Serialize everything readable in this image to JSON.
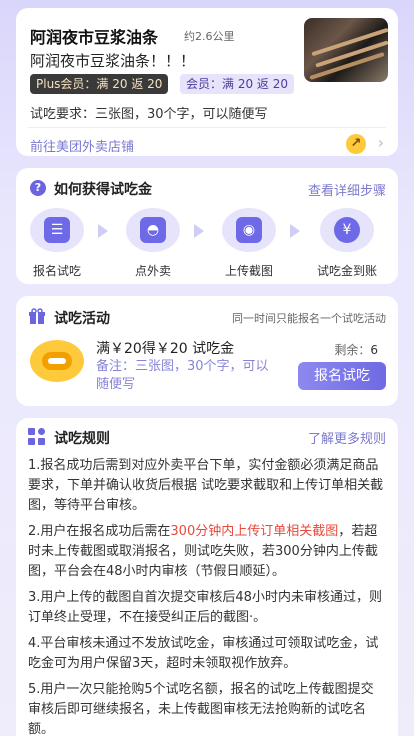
{
  "store": {
    "name": "阿润夜市豆浆油条",
    "distance": "约2.6公里",
    "subtitle": "阿润夜市豆浆油条！！！",
    "plus_badge": "Plus会员：满 20 返 20",
    "member_badge": "会员：满 20 返 20",
    "requirement": "试吃要求：三张图，30个字，可以随便写",
    "link_text": "前往美团外卖店铺"
  },
  "howto": {
    "title": "如何获得试吃金",
    "detail_link": "查看详细步骤",
    "steps": [
      {
        "label": "报名试吃",
        "icon": "clipboard-icon"
      },
      {
        "label": "点外卖",
        "icon": "food-cloche-icon"
      },
      {
        "label": "上传截图",
        "icon": "camera-icon"
      },
      {
        "label": "试吃金到账",
        "icon": "yen-coin-icon"
      }
    ]
  },
  "activity": {
    "title": "试吃活动",
    "note": "同一时间只能报名一个试吃活动",
    "offer": "满￥20得￥20 试吃金",
    "remark": "备注：三张图，30个字，可以随便写",
    "remaining_label": "剩余：",
    "remaining_value": "6",
    "button_label": "报名试吃"
  },
  "rules": {
    "title": "试吃规则",
    "more_link": "了解更多规则",
    "items": {
      "r1": "1.报名成功后需到对应外卖平台下单，实付金额必须满足商品要求，下单并确认收货后根据 试吃要求截取和上传订单相关截图，等待平台审核。",
      "r2_pre": "2.用户在报名成功后需在",
      "r2_highlight": "300分钟内上传订单相关截图",
      "r2_post": "，若超时未上传截图或取消报名，则试吃失败，若300分钟内上传截图，平台会在48小时内审核（节假日顺延）。",
      "r3": "3.用户上传的截图自首次提交审核后48小时内未审核通过，则订单终止受理，不在接受纠正后的截图·。",
      "r4": "4.平台审核未通过不发放试吃金，审核通过可领取试吃金，试吃金可为用户保留3天，超时未领取视作放弃。",
      "r5": "5.用户一次只能抢购5个试吃名额，报名的试吃上传截图提交审核后即可继续报名，未上传截图审核无法抢购新的试吃名额。"
    }
  },
  "colors": {
    "accent": "#6e69e6",
    "link": "#7b79cf",
    "highlight": "#e64b3c",
    "badge_dark": "#3a3a3a"
  }
}
